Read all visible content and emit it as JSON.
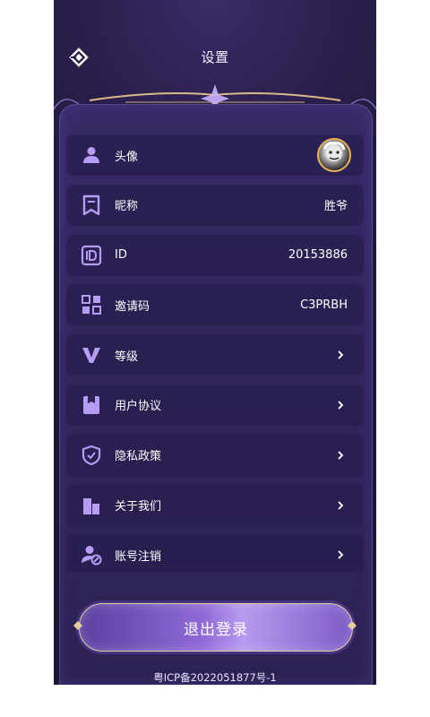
{
  "header": {
    "title": "设置"
  },
  "settings": {
    "items": [
      {
        "label": "头像",
        "icon": "user-icon"
      },
      {
        "label": "昵称",
        "value": "胜爷",
        "icon": "bookmark-icon"
      },
      {
        "label": "ID",
        "value": "20153886",
        "icon": "id-icon"
      },
      {
        "label": "邀请码",
        "value": "C3PRBH",
        "icon": "qr-grid-icon"
      },
      {
        "label": "等级",
        "icon": "level-v-icon"
      },
      {
        "label": "用户协议",
        "icon": "agreement-icon"
      },
      {
        "label": "隐私政策",
        "icon": "shield-check-icon"
      },
      {
        "label": "关于我们",
        "icon": "building-icon"
      },
      {
        "label": "账号注销",
        "icon": "user-remove-icon"
      }
    ]
  },
  "logout": {
    "label": "退出登录"
  },
  "footer": {
    "icp": "粤ICP备2022051877号-1"
  },
  "colors": {
    "accent": "#a98ae8",
    "gold": "#e2cf9b",
    "background": "#221a40"
  }
}
